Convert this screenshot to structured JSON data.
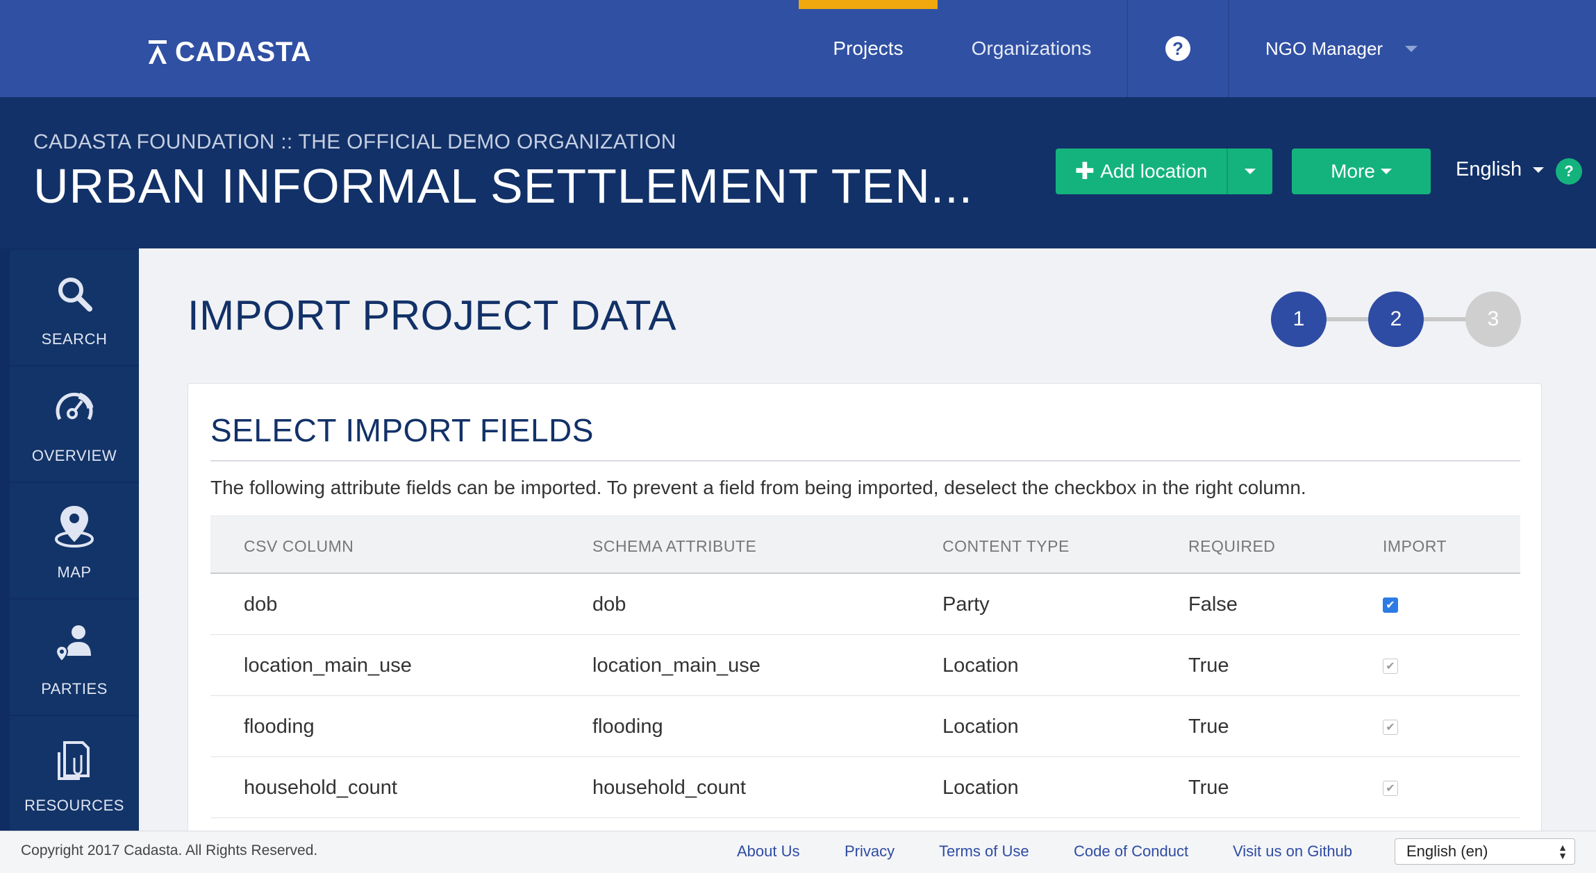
{
  "topnav": {
    "logo_text": "CADASTA",
    "projects": "Projects",
    "organizations": "Organizations",
    "help_glyph": "?",
    "user": "NGO Manager"
  },
  "project_header": {
    "organization": "CADASTA FOUNDATION :: THE OFFICIAL DEMO ORGANIZATION",
    "title": "URBAN INFORMAL SETTLEMENT TEN...",
    "add_location": "Add location",
    "more": "More",
    "language": "English",
    "lang_help_glyph": "?"
  },
  "sidebar": {
    "items": [
      {
        "label": "SEARCH",
        "icon": "search-icon"
      },
      {
        "label": "OVERVIEW",
        "icon": "dashboard-icon"
      },
      {
        "label": "MAP",
        "icon": "map-pin-icon"
      },
      {
        "label": "PARTIES",
        "icon": "person-icon"
      },
      {
        "label": "RESOURCES",
        "icon": "document-icon"
      }
    ]
  },
  "main": {
    "page_title": "IMPORT PROJECT DATA",
    "steps": [
      "1",
      "2",
      "3"
    ],
    "current_step": 2,
    "card_title": "SELECT IMPORT FIELDS",
    "description": "The following attribute fields can be imported. To prevent a field from being imported, deselect the checkbox in the right column.",
    "columns": [
      "CSV COLUMN",
      "SCHEMA ATTRIBUTE",
      "CONTENT TYPE",
      "REQUIRED",
      "IMPORT"
    ],
    "rows": [
      {
        "csv": "dob",
        "schema": "dob",
        "type": "Party",
        "required": "False",
        "import": true,
        "editable": true
      },
      {
        "csv": "location_main_use",
        "schema": "location_main_use",
        "type": "Location",
        "required": "True",
        "import": true,
        "editable": false
      },
      {
        "csv": "flooding",
        "schema": "flooding",
        "type": "Location",
        "required": "True",
        "import": true,
        "editable": false
      },
      {
        "csv": "household_count",
        "schema": "household_count",
        "type": "Location",
        "required": "True",
        "import": true,
        "editable": false
      }
    ]
  },
  "footer": {
    "copyright": "Copyright 2017 Cadasta. All Rights Reserved.",
    "links": [
      "About Us",
      "Privacy",
      "Terms of Use",
      "Code of Conduct",
      "Visit us on Github"
    ],
    "language_select": "English (en)"
  },
  "colors": {
    "nav_blue": "#3050a3",
    "header_navy": "#123168",
    "accent_green": "#14b37d",
    "active_tab": "#f0a80e"
  }
}
